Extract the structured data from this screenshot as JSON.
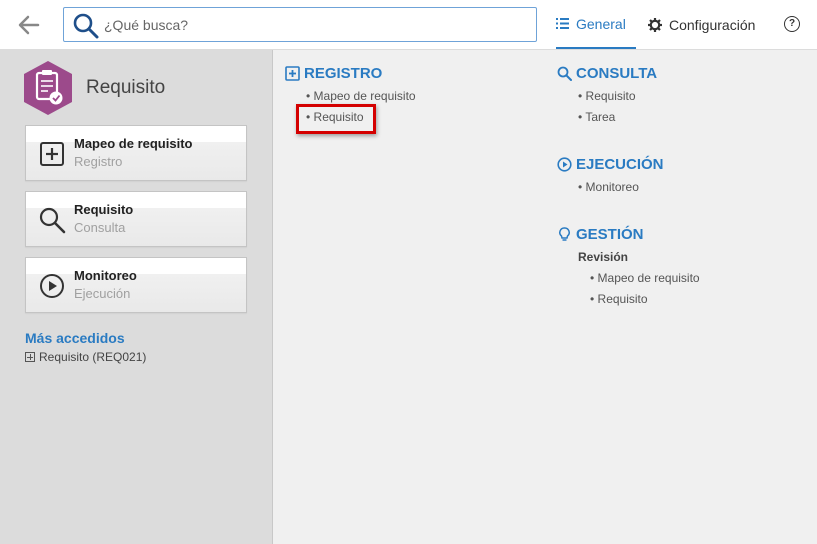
{
  "topbar": {
    "search_placeholder": "¿Qué busca?",
    "tab_general": "General",
    "tab_config": "Configuración",
    "help_symbol": "?",
    "accent": "#2a7bc2"
  },
  "sidebar": {
    "app_title": "Requisito",
    "cards": [
      {
        "title": "Mapeo de requisito",
        "subtitle": "Registro",
        "icon": "plus-square-icon"
      },
      {
        "title": "Requisito",
        "subtitle": "Consulta",
        "icon": "search-icon"
      },
      {
        "title": "Monitoreo",
        "subtitle": "Ejecución",
        "icon": "play-circle-icon"
      }
    ],
    "most_accessed_title": "Más accedidos",
    "most_accessed_item": "Requisito (REQ021)"
  },
  "main": {
    "registro": {
      "title": "REGISTRO",
      "items": [
        "• Mapeo de requisito",
        "• Requisito"
      ]
    },
    "consulta": {
      "title": "CONSULTA",
      "items": [
        "• Requisito",
        "• Tarea"
      ]
    },
    "ejecucion": {
      "title": "EJECUCIÓN",
      "items": [
        "• Monitoreo"
      ]
    },
    "gestion": {
      "title": "GESTIÓN",
      "subhead": "Revisión",
      "items": [
        "• Mapeo de requisito",
        "• Requisito"
      ]
    }
  }
}
